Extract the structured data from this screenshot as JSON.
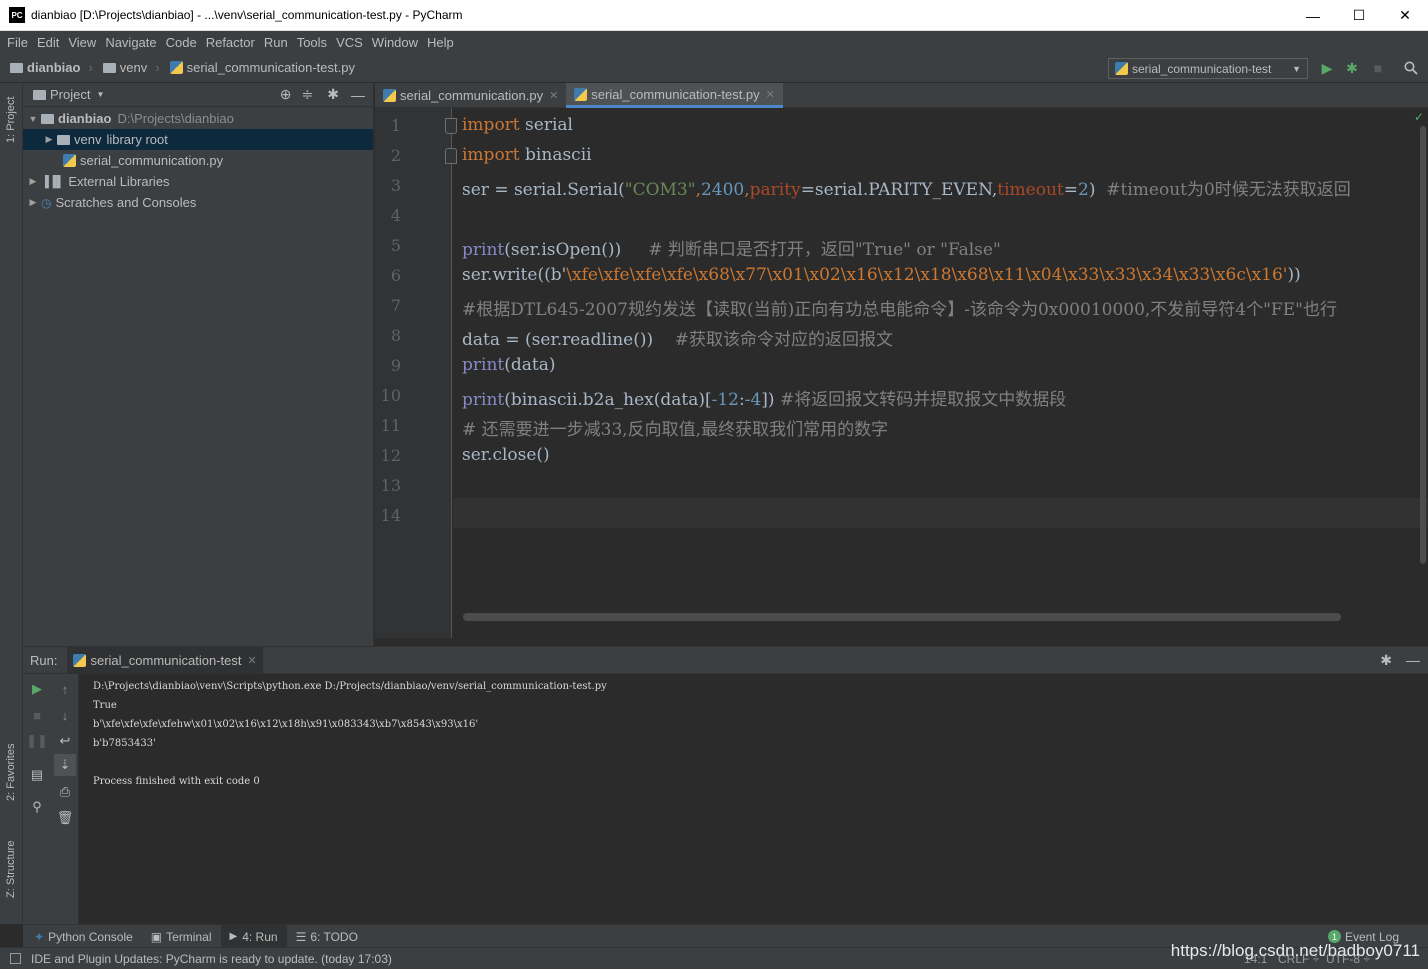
{
  "window": {
    "title": "dianbiao [D:\\Projects\\dianbiao] - ...\\venv\\serial_communication-test.py - PyCharm",
    "logo": "PC",
    "minimize": "—",
    "maximize": "☐",
    "close": "✕"
  },
  "menu": [
    "File",
    "Edit",
    "View",
    "Navigate",
    "Code",
    "Refactor",
    "Run",
    "Tools",
    "VCS",
    "Window",
    "Help"
  ],
  "breadcrumb": [
    "dianbiao",
    "venv",
    "serial_communication-test.py"
  ],
  "run_config": "serial_communication-test",
  "sidestrip": {
    "project": "1: Project",
    "favorites": "2: Favorites",
    "structure": "Z: Structure"
  },
  "project": {
    "title": "Project",
    "tree": [
      {
        "label": "dianbiao",
        "path": "D:\\Projects\\dianbiao"
      },
      {
        "label": "venv",
        "extra": "library root"
      },
      {
        "label": "serial_communication.py"
      },
      {
        "label": "External Libraries"
      },
      {
        "label": "Scratches and Consoles"
      }
    ]
  },
  "tabs": [
    {
      "label": "serial_communication.py"
    },
    {
      "label": "serial_communication-test.py"
    }
  ],
  "line_numbers": [
    "1",
    "2",
    "3",
    "4",
    "5",
    "6",
    "7",
    "8",
    "9",
    "10",
    "11",
    "12",
    "13",
    "14"
  ],
  "code": {
    "l1a": "import",
    "l1b": " serial",
    "l2a": "import",
    "l2b": " binascii",
    "l3a": "ser = serial.Serial(",
    "l3b": "\"COM3\"",
    "l3c": ",",
    "l3d": "2400",
    ",l3e": ",",
    "l3f": "parity",
    "l3g": "=serial.PARITY_EVEN,",
    "l3h": "timeout",
    "l3i": "=",
    "l3j": "2",
    ")l3k": ")",
    "l3l": "  #timeout为0时候无法获取返回",
    "l5a": "print",
    "l5b": "(ser.isOpen())",
    "l5c": "     # 判断串口是否打开，返回\"True\" or \"False\"",
    "l6a": "ser.write((b'",
    "l6b": "\\xfe\\xfe\\xfe\\xfe\\x68\\x77\\x01\\x02\\x16\\x12\\x18\\x68\\x11\\x04\\x33\\x33\\x34\\x33\\x6c\\x16'",
    "l6c": "))",
    "l7": "#根据DTL645-2007规约发送【读取(当前)正向有功总电能命令】-该命令为0x00010000,不发前导符4个\"FE\"也行",
    "l8a": "data = (ser.readline())",
    "l8b": "    #获取该命令对应的返回报文",
    "l9a": "print",
    "l9b": "(data)",
    "l10a": "print",
    "l10b": "(binascii.b2a_hex(data)[",
    "l10c": "-12",
    "l10d": ":",
    "l10e": "-4",
    "l10f": "])",
    "l10g": " #将返回报文转码并提取报文中数据段",
    "l11": "# 还需要进一步减33,反向取值,最终获取我们常用的数字",
    "l12": "ser.close()"
  },
  "run": {
    "label": "Run:",
    "tab": "serial_communication-test",
    "console": [
      "D:\\Projects\\dianbiao\\venv\\Scripts\\python.exe D:/Projects/dianbiao/venv/serial_communication-test.py",
      "True",
      "b'\\xfe\\xfe\\xfe\\xfehw\\x01\\x02\\x16\\x12\\x18h\\x91\\x083343\\xb7\\x8543\\x93\\x16'",
      "b'b7853433'",
      "",
      "Process finished with exit code 0"
    ]
  },
  "bottom_tabs": [
    "Python Console",
    "Terminal",
    "4: Run",
    "6: TODO"
  ],
  "event_log": {
    "count": "1",
    "label": "Event Log"
  },
  "status": {
    "message": "IDE and Plugin Updates: PyCharm is ready to update. (today 17:03)",
    "pos": "14:1",
    "sep": "CRLF ÷",
    "enc": "UTF-8 ÷"
  },
  "watermark": "https://blog.csdn.net/badboy0711"
}
